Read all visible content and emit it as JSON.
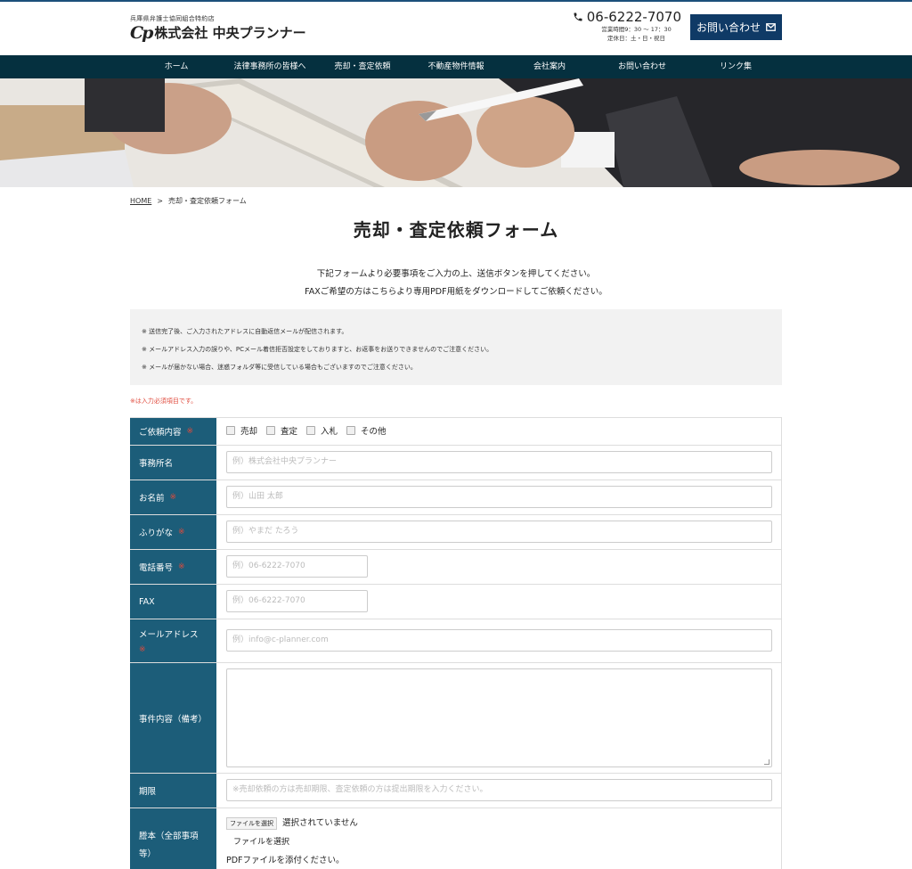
{
  "header": {
    "sub": "兵庫県弁護士協同組合特約店",
    "logo": "Cp",
    "company": "株式会社 中央プランナー",
    "phone": "06-6222-7070",
    "hours": "営業時間9：30 〜 17：30",
    "holiday": "定休日：土・日・祝日",
    "contact_label": "お問い合わせ"
  },
  "nav": [
    "ホーム",
    "法律事務所の皆様へ",
    "売却・査定依頼",
    "不動産物件情報",
    "会社案内",
    "お問い合わせ",
    "リンク集"
  ],
  "breadcrumb": {
    "home": "HOME",
    "sep": ">",
    "current": "売却・査定依頼フォーム"
  },
  "page_title": "売却・査定依頼フォーム",
  "intro": [
    "下記フォームより必要事項をご入力の上、送信ボタンを押してください。",
    "FAXご希望の方はこちらより専用PDF用紙をダウンロードしてご依頼ください。"
  ],
  "notices": [
    "※ 送信完了後、ご入力されたアドレスに自動返信メールが配信されます。",
    "※ メールアドレス入力の誤りや、PCメール着信拒否設定をしておりますと、お返事をお送りできませんのでご注意ください。",
    "※ メールが届かない場合、迷惑フォルダ等に受信している場合もございますのでご注意ください。"
  ],
  "required_note": "※は入力必須項目です。",
  "required_mark": "※",
  "form": {
    "request_type": {
      "label": "ご依頼内容",
      "options": [
        "売却",
        "査定",
        "入札",
        "その他"
      ]
    },
    "office": {
      "label": "事務所名",
      "placeholder": "例）株式会社中央プランナー"
    },
    "name": {
      "label": "お名前",
      "placeholder": "例）山田 太郎"
    },
    "kana": {
      "label": "ふりがな",
      "placeholder": "例）やまだ たろう"
    },
    "tel": {
      "label": "電話番号",
      "placeholder": "例）06-6222-7070"
    },
    "fax": {
      "label": "FAX",
      "placeholder": "例）06-6222-7070"
    },
    "email": {
      "label": "メールアドレス",
      "placeholder": "例）info@c-planner.com"
    },
    "details": {
      "label": "事件内容（備考）"
    },
    "deadline": {
      "label": "期限",
      "placeholder": "※売却依頼の方は売却期限、査定依頼の方は提出期限を入力ください。"
    },
    "register": {
      "label_line1": "謄本（全部事項",
      "label_line2": "等）",
      "button": "ファイルを選択",
      "status": "選択されていません",
      "file_label": "ファイルを選択",
      "help": "PDFファイルを添付ください。"
    }
  },
  "colors": {
    "nav_bg": "#05303f",
    "label_bg": "#1c5d79",
    "contact_bg": "#0f3a66",
    "required": "#e04a3c"
  }
}
